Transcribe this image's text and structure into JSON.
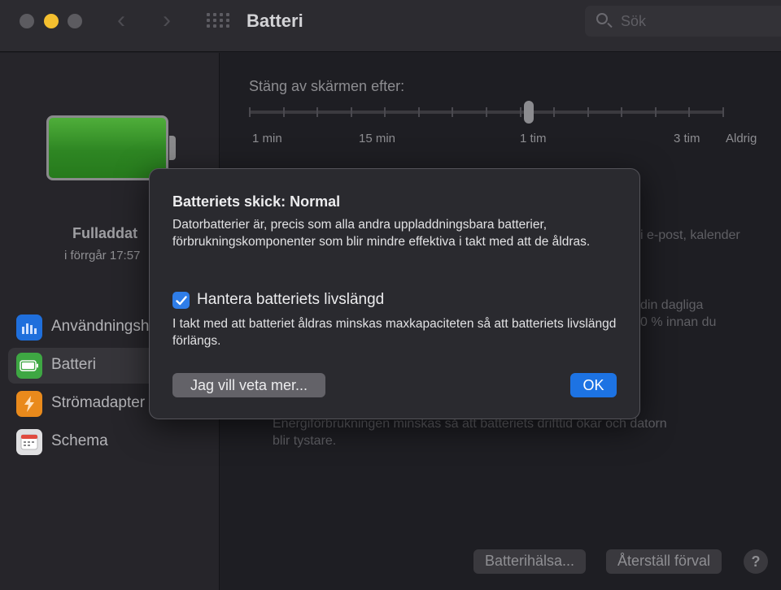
{
  "window": {
    "title": "Batteri",
    "search_placeholder": "Sök",
    "nav_back_icon": "chevron-left-icon",
    "nav_forward_icon": "chevron-right-icon",
    "grid_icon": "show-all-grid-icon"
  },
  "sidebar": {
    "battery_status": "Fulladdat",
    "battery_time": "i förrgår 17:57",
    "battery_level_fraction": 1.0,
    "items": [
      {
        "label": "Användningshistorik",
        "icon": "bar-chart-icon",
        "color": "#1f6fdc"
      },
      {
        "label": "Batteri",
        "icon": "battery-icon",
        "color": "#3ea743"
      },
      {
        "label": "Strömadapter",
        "icon": "lightning-icon",
        "color": "#e98a1c"
      },
      {
        "label": "Schema",
        "icon": "calendar-icon",
        "color": "#e0e0e2"
      }
    ],
    "selected_index": 1
  },
  "main": {
    "slider_title": "Stäng av skärmen efter:",
    "slider_labels": [
      "1 min",
      "15 min",
      "1 tim",
      "3 tim",
      "Aldrig"
    ],
    "slider_value": "1 tim",
    "bg_text_1": "i e-post, kalender",
    "bg_text_2": "din dagliga",
    "bg_text_3": "0 % innan du",
    "bg_text_4": "Energiförbrukningen minskas så att batteriets drifttid ökar och datorn",
    "bg_text_5": "blir tystare.",
    "health_button": "Batterihälsa...",
    "reset_button": "Återställ förval",
    "help_button": "?"
  },
  "dialog": {
    "title": "Batteriets skick: Normal",
    "body": "Datorbatterier är, precis som alla andra uppladdningsbara batterier, förbrukningskomponenter som blir mindre effektiva i takt med att de åldras.",
    "checkbox_label": "Hantera batteriets livslängd",
    "checkbox_checked": true,
    "checkbox_description": "I takt med att batteriet åldras minskas maxkapaciteten så att batteriets livslängd förlängs.",
    "more_button": "Jag vill veta mer...",
    "ok_button": "OK"
  },
  "colors": {
    "accent": "#1d73e3",
    "battery_fill": "#2e8623"
  }
}
